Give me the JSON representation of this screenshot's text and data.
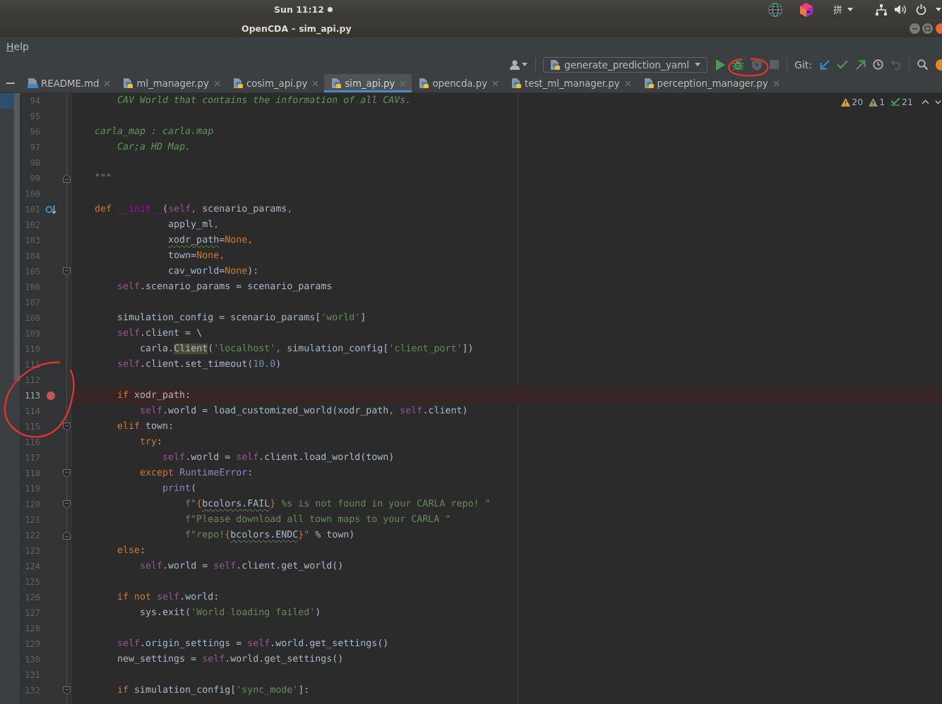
{
  "system_bar": {
    "clock": "Sun 11:12",
    "input_method": "拼"
  },
  "window": {
    "title": "OpenCDA – sim_api.py"
  },
  "menu_bar": [
    "Help"
  ],
  "toolbar": {
    "run_config": "generate_prediction_yaml",
    "git_label": "Git:"
  },
  "tabs": [
    {
      "label": "README.md",
      "kind": "markdown",
      "selected": false
    },
    {
      "label": "ml_manager.py",
      "kind": "python",
      "selected": false
    },
    {
      "label": "cosim_api.py",
      "kind": "python",
      "selected": false
    },
    {
      "label": "sim_api.py",
      "kind": "python",
      "selected": true
    },
    {
      "label": "opencda.py",
      "kind": "python",
      "selected": false
    },
    {
      "label": "test_ml_manager.py",
      "kind": "python",
      "selected": false
    },
    {
      "label": "perception_manager.py",
      "kind": "python",
      "selected": false
    }
  ],
  "inspections": [
    {
      "kind": "warning",
      "count": "20"
    },
    {
      "kind": "weak_warning",
      "count": "1"
    },
    {
      "kind": "typo",
      "count": "21"
    }
  ],
  "editor": {
    "lines": [
      {
        "number": "94",
        "kind": "plain",
        "breakpoint": false,
        "tokens": [
          {
            "text": "        CAV World that contains the information of all CAVs.",
            "kind": "doc"
          }
        ]
      },
      {
        "number": "95",
        "kind": "plain",
        "breakpoint": false
      },
      {
        "number": "96",
        "kind": "plain",
        "breakpoint": false,
        "tokens": [
          {
            "text": "    carla_map : carla.map",
            "kind": "doc"
          }
        ]
      },
      {
        "number": "97",
        "kind": "plain",
        "breakpoint": false,
        "tokens": [
          {
            "text": "        Car;a HD Map.",
            "kind": "doc"
          }
        ]
      },
      {
        "number": "98",
        "kind": "plain",
        "breakpoint": false
      },
      {
        "number": "99",
        "kind": "fold_end",
        "breakpoint": false,
        "tokens": [
          {
            "text": "    \"\"\"",
            "kind": "doc"
          }
        ]
      },
      {
        "number": "100",
        "kind": "plain",
        "breakpoint": false
      },
      {
        "number": "101",
        "kind": "override",
        "breakpoint": false,
        "tokens": [
          {
            "text": "    def ",
            "kind": "kw"
          },
          {
            "text": "__init__",
            "kind": "magic"
          },
          {
            "text": "(",
            "kind": "plain"
          },
          {
            "text": "self",
            "kind": "self"
          },
          {
            "text": ",",
            "kind": "punct"
          },
          {
            "text": " scenario_params",
            "kind": "plain"
          },
          {
            "text": ",",
            "kind": "punct"
          }
        ]
      },
      {
        "number": "102",
        "kind": "plain",
        "breakpoint": false,
        "tokens": [
          {
            "text": "                 apply_ml",
            "kind": "plain"
          },
          {
            "text": ",",
            "kind": "punct"
          }
        ]
      },
      {
        "number": "103",
        "kind": "plain",
        "breakpoint": false,
        "tokens": [
          {
            "text": "                 xodr_path",
            "kind": "typo"
          },
          {
            "text": "=",
            "kind": "plain"
          },
          {
            "text": "None",
            "kind": "kw"
          },
          {
            "text": ",",
            "kind": "punct"
          }
        ]
      },
      {
        "number": "104",
        "kind": "plain",
        "breakpoint": false,
        "tokens": [
          {
            "text": "                 town=",
            "kind": "plain"
          },
          {
            "text": "None",
            "kind": "kw"
          },
          {
            "text": ",",
            "kind": "punct"
          }
        ]
      },
      {
        "number": "105",
        "kind": "fold_start",
        "breakpoint": false,
        "tokens": [
          {
            "text": "                 cav_world=",
            "kind": "plain"
          },
          {
            "text": "None",
            "kind": "kw"
          },
          {
            "text": "):",
            "kind": "plain"
          }
        ]
      },
      {
        "number": "106",
        "kind": "plain",
        "breakpoint": false,
        "tokens": [
          {
            "text": "        self",
            "kind": "self"
          },
          {
            "text": ".scenario_params = scenario_params",
            "kind": "plain"
          }
        ]
      },
      {
        "number": "107",
        "kind": "plain",
        "breakpoint": false
      },
      {
        "number": "108",
        "kind": "plain",
        "breakpoint": false,
        "tokens": [
          {
            "text": "        simulation_config = scenario_params[",
            "kind": "plain"
          },
          {
            "text": "'world'",
            "kind": "str"
          },
          {
            "text": "]",
            "kind": "plain"
          }
        ]
      },
      {
        "number": "109",
        "kind": "plain",
        "breakpoint": false,
        "tokens": [
          {
            "text": "        self",
            "kind": "self"
          },
          {
            "text": ".client = \\",
            "kind": "plain"
          }
        ]
      },
      {
        "number": "110",
        "kind": "plain",
        "breakpoint": false,
        "tokens": [
          {
            "text": "            carla.",
            "kind": "plain"
          },
          {
            "text": "Client",
            "kind": "match"
          },
          {
            "text": "(",
            "kind": "plain"
          },
          {
            "text": "'localhost'",
            "kind": "str"
          },
          {
            "text": ",",
            "kind": "punct"
          },
          {
            "text": " simulation_config[",
            "kind": "plain"
          },
          {
            "text": "'client_port'",
            "kind": "str"
          },
          {
            "text": "])",
            "kind": "plain"
          }
        ]
      },
      {
        "number": "111",
        "kind": "plain",
        "breakpoint": false,
        "tokens": [
          {
            "text": "        self",
            "kind": "self"
          },
          {
            "text": ".client.set_timeout(",
            "kind": "plain"
          },
          {
            "text": "10.0",
            "kind": "num"
          },
          {
            "text": ")",
            "kind": "plain"
          }
        ]
      },
      {
        "number": "112",
        "kind": "plain",
        "breakpoint": false
      },
      {
        "number": "113",
        "kind": "plain",
        "breakpoint": true,
        "tokens": [
          {
            "text": "        if",
            "kind": "kw"
          },
          {
            "text": " xodr_path:",
            "kind": "plain"
          }
        ]
      },
      {
        "number": "114",
        "kind": "plain",
        "breakpoint": false,
        "tokens": [
          {
            "text": "            self",
            "kind": "self"
          },
          {
            "text": ".world = load_customized_world(xodr_path",
            "kind": "plain"
          },
          {
            "text": ", ",
            "kind": "punct"
          },
          {
            "text": "self",
            "kind": "self"
          },
          {
            "text": ".client)",
            "kind": "plain"
          }
        ]
      },
      {
        "number": "115",
        "kind": "fold_start",
        "breakpoint": false,
        "tokens": [
          {
            "text": "        elif",
            "kind": "kw"
          },
          {
            "text": " town:",
            "kind": "plain"
          }
        ]
      },
      {
        "number": "116",
        "kind": "plain",
        "breakpoint": false,
        "tokens": [
          {
            "text": "            try",
            "kind": "kw"
          },
          {
            "text": ":",
            "kind": "plain"
          }
        ]
      },
      {
        "number": "117",
        "kind": "plain",
        "breakpoint": false,
        "tokens": [
          {
            "text": "                self",
            "kind": "self"
          },
          {
            "text": ".world = ",
            "kind": "plain"
          },
          {
            "text": "self",
            "kind": "self"
          },
          {
            "text": ".client.load_world(town)",
            "kind": "plain"
          }
        ]
      },
      {
        "number": "118",
        "kind": "fold_start",
        "breakpoint": false,
        "tokens": [
          {
            "text": "            except ",
            "kind": "kw"
          },
          {
            "text": "RuntimeError",
            "kind": "builtin"
          },
          {
            "text": ":",
            "kind": "plain"
          }
        ]
      },
      {
        "number": "119",
        "kind": "plain",
        "breakpoint": false,
        "tokens": [
          {
            "text": "                print",
            "kind": "builtin"
          },
          {
            "text": "(",
            "kind": "plain"
          }
        ]
      },
      {
        "number": "120",
        "kind": "fold_start",
        "breakpoint": false,
        "tokens": [
          {
            "text": "                    f\"",
            "kind": "str"
          },
          {
            "text": "{",
            "kind": "punct"
          },
          {
            "text": "bcolors.FAIL",
            "kind": "typo"
          },
          {
            "text": "}",
            "kind": "punct"
          },
          {
            "text": " %s is not found in your CARLA repo! \"",
            "kind": "str"
          }
        ]
      },
      {
        "number": "121",
        "kind": "plain",
        "breakpoint": false,
        "tokens": [
          {
            "text": "                    f\"Please download all town maps to your CARLA \"",
            "kind": "str"
          }
        ]
      },
      {
        "number": "122",
        "kind": "fold_end",
        "breakpoint": false,
        "tokens": [
          {
            "text": "                    f\"repo!",
            "kind": "str"
          },
          {
            "text": "{",
            "kind": "punct"
          },
          {
            "text": "bcolors.ENDC",
            "kind": "typo"
          },
          {
            "text": "}",
            "kind": "punct"
          },
          {
            "text": "\"",
            "kind": "str"
          },
          {
            "text": " % town)",
            "kind": "plain"
          }
        ]
      },
      {
        "number": "123",
        "kind": "plain",
        "breakpoint": false,
        "tokens": [
          {
            "text": "        else",
            "kind": "kw"
          },
          {
            "text": ":",
            "kind": "plain"
          }
        ]
      },
      {
        "number": "124",
        "kind": "plain",
        "breakpoint": false,
        "tokens": [
          {
            "text": "            self",
            "kind": "self"
          },
          {
            "text": ".world = ",
            "kind": "plain"
          },
          {
            "text": "self",
            "kind": "self"
          },
          {
            "text": ".client.get_world()",
            "kind": "plain"
          }
        ]
      },
      {
        "number": "125",
        "kind": "plain",
        "breakpoint": false
      },
      {
        "number": "126",
        "kind": "plain",
        "breakpoint": false,
        "tokens": [
          {
            "text": "        if not ",
            "kind": "kw"
          },
          {
            "text": "self",
            "kind": "self"
          },
          {
            "text": ".world:",
            "kind": "plain"
          }
        ]
      },
      {
        "number": "127",
        "kind": "plain",
        "breakpoint": false,
        "tokens": [
          {
            "text": "            sys.exit(",
            "kind": "plain"
          },
          {
            "text": "'World loading failed'",
            "kind": "str"
          },
          {
            "text": ")",
            "kind": "plain"
          }
        ]
      },
      {
        "number": "128",
        "kind": "plain",
        "breakpoint": false
      },
      {
        "number": "129",
        "kind": "plain",
        "breakpoint": false,
        "tokens": [
          {
            "text": "        self",
            "kind": "self"
          },
          {
            "text": ".origin_settings = ",
            "kind": "plain"
          },
          {
            "text": "self",
            "kind": "self"
          },
          {
            "text": ".world.get_settings()",
            "kind": "plain"
          }
        ]
      },
      {
        "number": "130",
        "kind": "plain",
        "breakpoint": false,
        "tokens": [
          {
            "text": "        new_settings = ",
            "kind": "plain"
          },
          {
            "text": "self",
            "kind": "self"
          },
          {
            "text": ".world.get_settings()",
            "kind": "plain"
          }
        ]
      },
      {
        "number": "131",
        "kind": "plain",
        "breakpoint": false
      },
      {
        "number": "132",
        "kind": "fold_start",
        "breakpoint": false,
        "tokens": [
          {
            "text": "        if",
            "kind": "kw"
          },
          {
            "text": " simulation_config[",
            "kind": "plain"
          },
          {
            "text": "'sync_mode'",
            "kind": "str"
          },
          {
            "text": "]:",
            "kind": "plain"
          }
        ]
      }
    ]
  }
}
